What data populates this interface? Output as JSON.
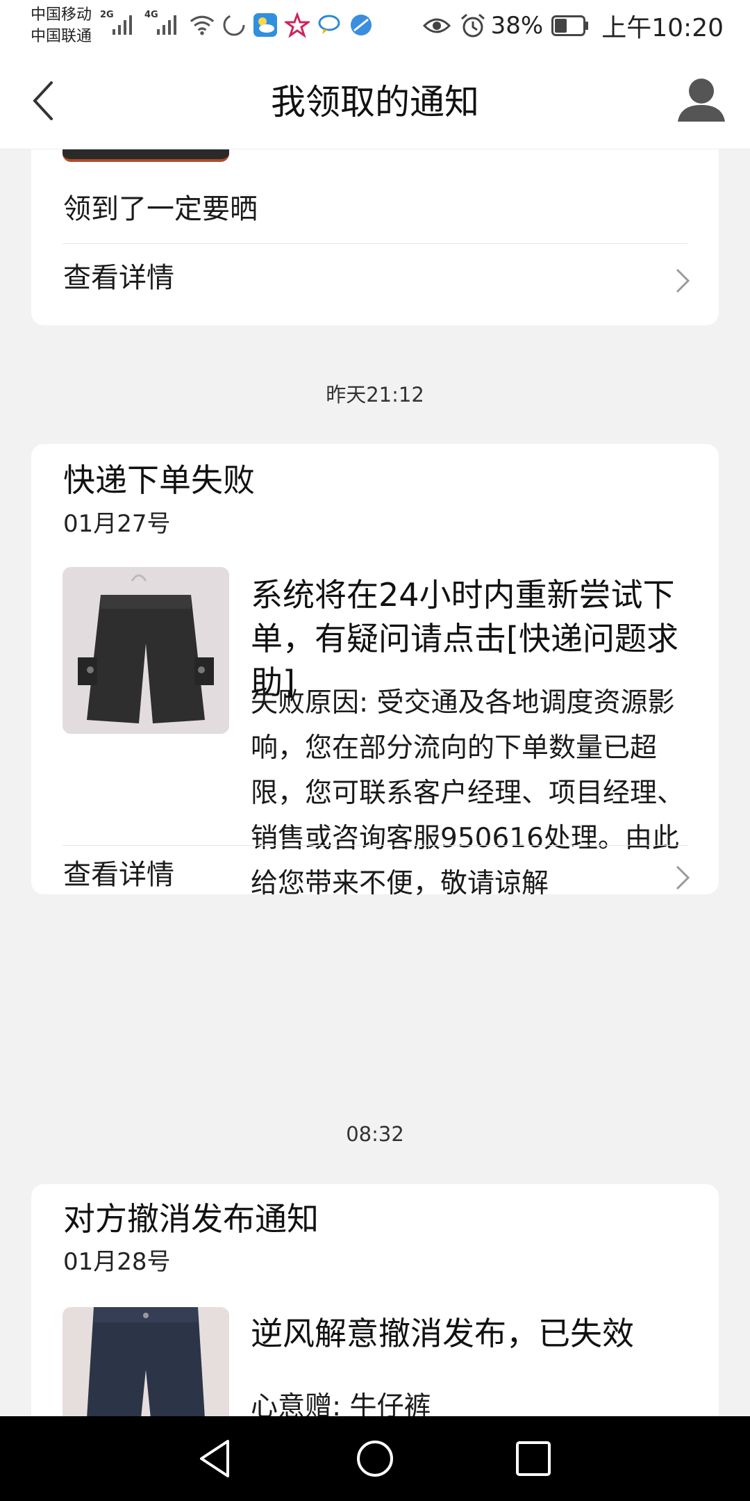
{
  "status_bar": {
    "carrier_1": "中国移动",
    "carrier_2": "中国联通",
    "net_1": "2G",
    "net_2": "4G",
    "battery": "38%",
    "time": "上午10:20",
    "icons": [
      "signal-icon",
      "signal-icon",
      "wifi-icon",
      "sync-icon",
      "weather-icon",
      "star-app-icon",
      "chat-app-icon",
      "browser-icon",
      "eye-icon",
      "alarm-icon",
      "battery-icon"
    ]
  },
  "header": {
    "title": "我领取的通知"
  },
  "notifications": [
    {
      "body": "领到了一定要晒",
      "detail_label": "查看详情"
    },
    {
      "time": "昨天21:12",
      "title": "快递下单失败",
      "date": "01月27号",
      "headline": "系统将在24小时内重新尝试下单，有疑问请点击[快递问题求助]",
      "body": "失败原因: 受交通及各地调度资源影响，您在部分流向的下单数量已超限，您可联系客户经理、项目经理、销售或咨询客服950616处理。由此给您带来不便，敬请谅解",
      "detail_label": "查看详情"
    },
    {
      "time": "08:32",
      "title": "对方撤消发布通知",
      "date": "01月28号",
      "headline": "逆风解意撤消发布，已失效",
      "body": "心意赠: 牛仔裤"
    }
  ],
  "colors": {
    "background": "#f2f2f2",
    "card": "#ffffff",
    "nav_bar": "#000000",
    "text": "#1a1a1a"
  }
}
